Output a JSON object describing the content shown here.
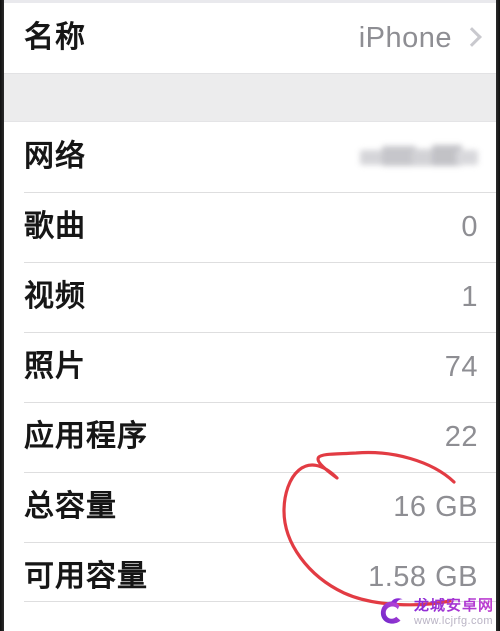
{
  "screen": {
    "platform_hint": "ios-settings-about-list",
    "background": "#ffffff",
    "separator_color": "#dededf",
    "group_gap_color": "#ececed",
    "label_color": "#161616",
    "value_color": "#8e8e93"
  },
  "name_row": {
    "label": "名称",
    "value": "iPhone",
    "chevron": "chevron-right-icon"
  },
  "rows": [
    {
      "label": "网络",
      "value": "",
      "redacted": true
    },
    {
      "label": "歌曲",
      "value": "0",
      "redacted": false
    },
    {
      "label": "视频",
      "value": "1",
      "redacted": false
    },
    {
      "label": "照片",
      "value": "74",
      "redacted": false
    },
    {
      "label": "应用程序",
      "value": "22",
      "redacted": false
    },
    {
      "label": "总容量",
      "value": "16 GB",
      "redacted": false
    },
    {
      "label": "可用容量",
      "value": "1.58 GB",
      "redacted": false
    }
  ],
  "annotation": {
    "type": "hand-drawn-circle",
    "color": "#e23b43",
    "targets": [
      "总容量",
      "可用容量"
    ],
    "stroke_width": 3
  },
  "watermark": {
    "title": "龙城安卓网",
    "url": "www.lcjrfg.com",
    "logo": "dragon-c-logo-icon",
    "color": "#8b2bd6"
  }
}
